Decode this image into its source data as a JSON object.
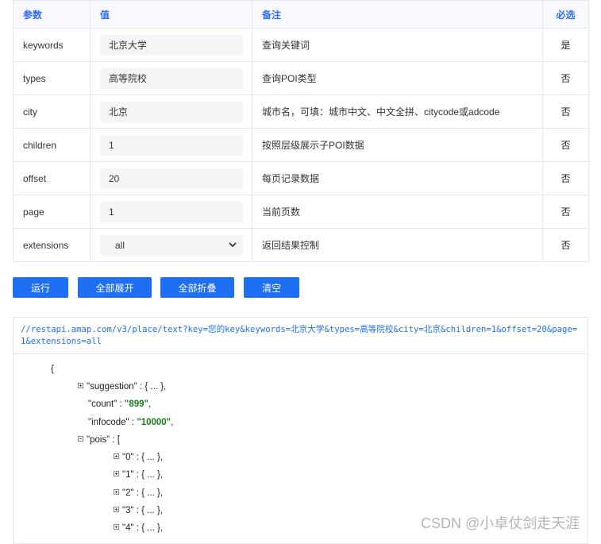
{
  "table": {
    "headers": {
      "param": "参数",
      "value": "值",
      "note": "备注",
      "required": "必选"
    },
    "rows": [
      {
        "name": "keywords",
        "value": "北京大学",
        "note": "查询关键词",
        "required": "是"
      },
      {
        "name": "types",
        "value": "高等院校",
        "note": "查询POI类型",
        "required": "否"
      },
      {
        "name": "city",
        "value": "北京",
        "note": "城市名，可填：城市中文、中文全拼、citycode或adcode",
        "required": "否"
      },
      {
        "name": "children",
        "value": "1",
        "note": "按照层级展示子POI数据",
        "required": "否"
      },
      {
        "name": "offset",
        "value": "20",
        "note": "每页记录数据",
        "required": "否"
      },
      {
        "name": "page",
        "value": "1",
        "note": "当前页数",
        "required": "否"
      },
      {
        "name": "extensions",
        "value": "all",
        "note": "返回结果控制",
        "required": "否"
      }
    ]
  },
  "buttons": {
    "run": "运行",
    "expand_all": "全部展开",
    "collapse_all": "全部折叠",
    "clear": "清空"
  },
  "request_url": "//restapi.amap.com/v3/place/text?key=您的key&keywords=北京大学&types=高等院校&city=北京&children=1&offset=20&page=1&extensions=all",
  "result": {
    "open_brace": "{",
    "suggestion_key": "\"suggestion\"",
    "collapsed": "{ ... },",
    "count_key": "\"count\"",
    "count_val": "\"899\"",
    "infocode_key": "\"infocode\"",
    "infocode_val": "\"10000\"",
    "pois_key": "\"pois\"",
    "pois_open": "[",
    "sep": " : ",
    "comma": ",",
    "pois_items": [
      "\"0\"",
      "\"1\"",
      "\"2\"",
      "\"3\"",
      "\"4\""
    ]
  },
  "watermark": "CSDN @小卓仗剑走天涯",
  "colors": {
    "accent": "#1f6ff5",
    "header_text": "#2f6df2",
    "number_green": "#1a7d1a"
  }
}
